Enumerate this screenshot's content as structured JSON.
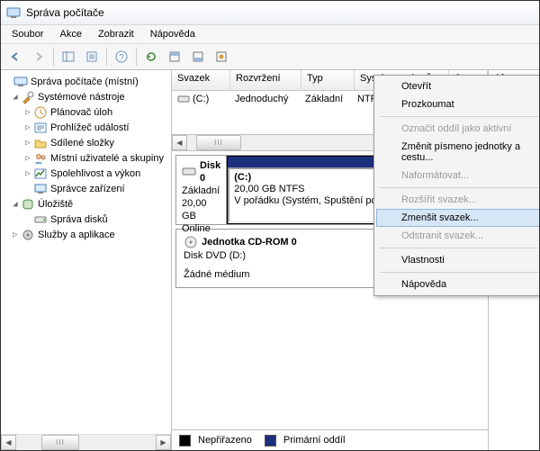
{
  "window": {
    "title": "Správa počítače"
  },
  "menubar": {
    "items": [
      "Soubor",
      "Akce",
      "Zobrazit",
      "Nápověda"
    ]
  },
  "tree": {
    "root": "Správa počítače (místní)",
    "system_tools": "Systémové nástroje",
    "task_scheduler": "Plánovač úloh",
    "event_viewer": "Prohlížeč událostí",
    "shared_folders": "Sdílené složky",
    "local_users": "Místní uživatelé a skupiny",
    "reliability": "Spolehlivost a výkon",
    "device_manager": "Správce zařízení",
    "storage": "Úložiště",
    "disk_management": "Správa disků",
    "services_apps": "Služby a aplikace"
  },
  "columns": {
    "volume": "Svazek",
    "layout": "Rozvržení",
    "type": "Typ",
    "filesystem": "Systém souborů",
    "status": "Stav"
  },
  "volumes": [
    {
      "label": "(C:)",
      "layout": "Jednoduchý",
      "type": "Základní",
      "fs": "NTFS"
    }
  ],
  "disk0": {
    "title": "Disk 0",
    "type": "Základní",
    "size": "20,00 GB",
    "status": "Online",
    "part_label": "(C:)",
    "part_info": "20,00 GB NTFS",
    "part_status": "V pořádku (Systém, Spuštění počítače, Stránkovací soubor)"
  },
  "cdrom": {
    "title": "Jednotka CD-ROM 0",
    "sub": "Disk DVD (D:)",
    "status": "Žádné médium"
  },
  "legend": {
    "unallocated": "Nepřiřazeno",
    "primary": "Primární oddíl"
  },
  "actions_header": "Akce",
  "context_menu": {
    "open": "Otevřít",
    "explore": "Prozkoumat",
    "mark_active": "Označit oddíl jako aktivní",
    "change_letter": "Změnit písmeno jednotky a cestu...",
    "format": "Naformátovat...",
    "extend": "Rozšířit svazek...",
    "shrink": "Zmenšit svazek...",
    "delete": "Odstranit svazek...",
    "properties": "Vlastnosti",
    "help": "Nápověda"
  },
  "scroll_thumb_glyph": "III"
}
